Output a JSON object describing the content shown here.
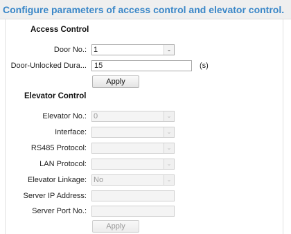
{
  "title": "Configure parameters of access control and elevator control.",
  "access_control": {
    "heading": "Access Control",
    "door_no_label": "Door No.:",
    "door_no_value": "1",
    "door_unlocked_label": "Door-Unlocked Dura...",
    "door_unlocked_value": "15",
    "unit": "(s)",
    "apply_label": "Apply"
  },
  "elevator_control": {
    "heading": "Elevator Control",
    "elevator_no_label": "Elevator No.:",
    "elevator_no_value": "0",
    "interface_label": "Interface:",
    "interface_value": "",
    "rs485_label": "RS485 Protocol:",
    "rs485_value": "",
    "lan_label": "LAN Protocol:",
    "lan_value": "",
    "linkage_label": "Elevator Linkage:",
    "linkage_value": "No",
    "server_ip_label": "Server IP Address:",
    "server_ip_value": "",
    "server_port_label": "Server Port No.:",
    "server_port_value": "",
    "apply_label": "Apply"
  },
  "icons": {
    "dropdown": "chevron-down-icon"
  }
}
